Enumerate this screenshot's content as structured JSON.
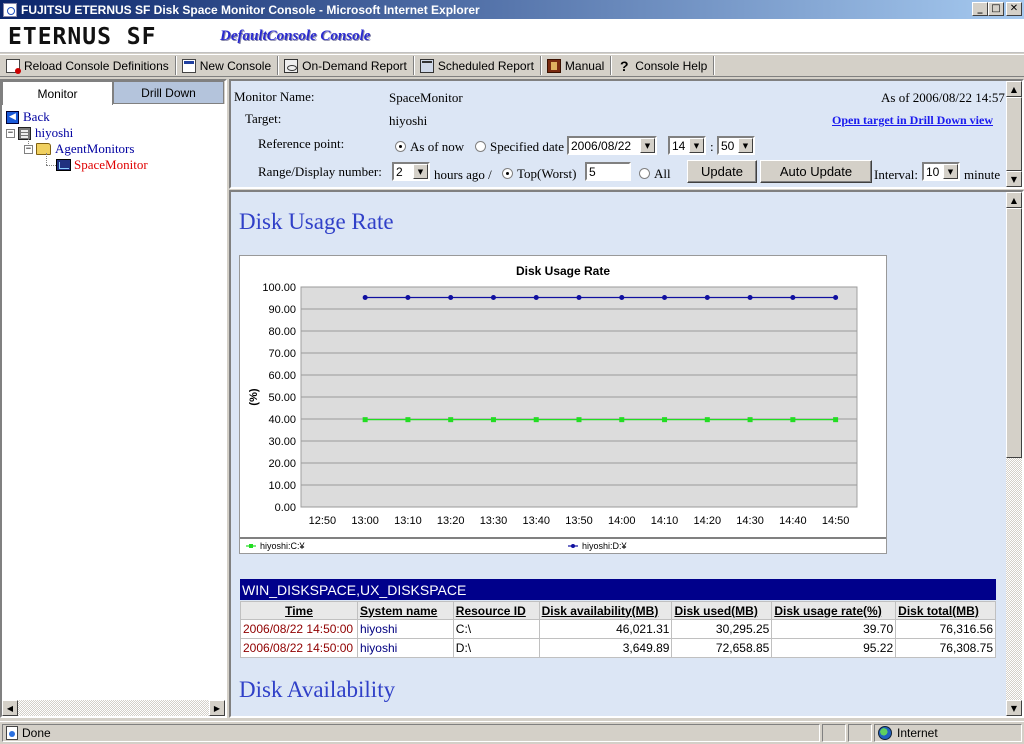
{
  "window": {
    "title": "FUJITSU ETERNUS SF Disk Space Monitor Console - Microsoft Internet Explorer",
    "minimize": "_",
    "maximize": "□",
    "close": "✕"
  },
  "header": {
    "brand": "ETERNUS SF",
    "console_title": "DefaultConsole Console"
  },
  "toolbar": {
    "reload": "Reload Console Definitions",
    "new_console": "New Console",
    "on_demand": "On-Demand Report",
    "scheduled": "Scheduled Report",
    "manual": "Manual",
    "help": "Console Help"
  },
  "left": {
    "tab_monitor": "Monitor",
    "tab_drilldown": "Drill Down",
    "tree": {
      "back": "Back",
      "host": "hiyoshi",
      "agent_monitors": "AgentMonitors",
      "space_monitor": "SpaceMonitor"
    }
  },
  "controls": {
    "monitor_name_label": "Monitor Name:",
    "monitor_name": "SpaceMonitor",
    "as_of": "As of 2006/08/22 14:57",
    "target_label": "Target:",
    "target": "hiyoshi",
    "drill_link": "Open target in Drill Down view",
    "reference_label": "Reference point:",
    "as_of_now": "As of now",
    "specified_date": "Specified date",
    "date_value": "2006/08/22",
    "hour_value": "14",
    "colon": ":",
    "minute_value": "50",
    "range_label": "Range/Display number:",
    "range_value": "2",
    "hours_ago": "hours ago /",
    "top_worst": "Top(Worst)",
    "top_value": "5",
    "all": "All",
    "update": "Update",
    "auto_update": "Auto Update",
    "interval_label": "Interval:",
    "interval_value": "10",
    "minute_label": "minute"
  },
  "main": {
    "heading_usage": "Disk Usage Rate",
    "heading_availability": "Disk Availability"
  },
  "chart_data": {
    "type": "line",
    "title": "Disk Usage Rate",
    "xlabel": "",
    "ylabel": "(%)",
    "ylim": [
      0,
      100
    ],
    "yticks": [
      "0.00",
      "10.00",
      "20.00",
      "30.00",
      "40.00",
      "50.00",
      "60.00",
      "70.00",
      "80.00",
      "90.00",
      "100.00"
    ],
    "categories": [
      "12:50",
      "13:00",
      "13:10",
      "13:20",
      "13:30",
      "13:40",
      "13:50",
      "14:00",
      "14:10",
      "14:20",
      "14:30",
      "14:40",
      "14:50"
    ],
    "grid": true,
    "legend_position": "bottom",
    "series": [
      {
        "name": "hiyoshi:C:¥",
        "color": "#22dd22",
        "values": [
          null,
          39.7,
          39.7,
          39.7,
          39.7,
          39.7,
          39.7,
          39.7,
          39.7,
          39.7,
          39.7,
          39.7,
          39.7
        ]
      },
      {
        "name": "hiyoshi:D:¥",
        "color": "#1010a0",
        "values": [
          null,
          95.22,
          95.22,
          95.22,
          95.22,
          95.22,
          95.22,
          95.22,
          95.22,
          95.22,
          95.22,
          95.22,
          95.22
        ]
      }
    ]
  },
  "table": {
    "caption": "WIN_DISKSPACE,UX_DISKSPACE",
    "columns": [
      "Time",
      "System name",
      "Resource ID",
      "Disk availability(MB)",
      "Disk used(MB)",
      "Disk usage rate(%)",
      "Disk total(MB)"
    ],
    "rows": [
      [
        "2006/08/22 14:50:00",
        "hiyoshi",
        "C:\\",
        "46,021.31",
        "30,295.25",
        "39.70",
        "76,316.56"
      ],
      [
        "2006/08/22 14:50:00",
        "hiyoshi",
        "D:\\",
        "3,649.89",
        "72,658.85",
        "95.22",
        "76,308.75"
      ]
    ]
  },
  "status": {
    "done": "Done",
    "zone": "Internet"
  }
}
